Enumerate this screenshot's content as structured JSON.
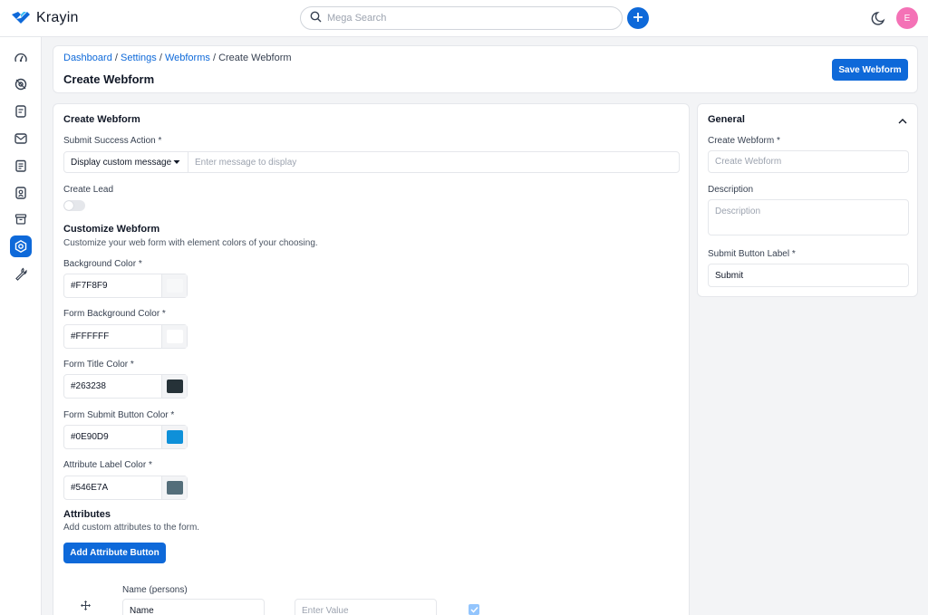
{
  "app": {
    "brand": "Krayin",
    "search_placeholder": "Mega Search",
    "user_initial": "E"
  },
  "icons": {
    "logo": "krayin-logo-icon",
    "search": "search-icon",
    "add": "plus-icon",
    "theme": "moon-icon",
    "sidebar": [
      "dashboard-icon",
      "leads-icon",
      "quotes-icon",
      "mail-icon",
      "activities-icon",
      "contacts-icon",
      "products-icon",
      "settings-icon",
      "configuration-icon"
    ],
    "collapse": "chevron-up-icon",
    "drag": "drag-handle-icon",
    "check": "check-icon"
  },
  "colors": {
    "accent": "#0E69D9",
    "avatar": "#F472B6"
  },
  "breadcrumb": {
    "dashboard": "Dashboard",
    "settings": "Settings",
    "webforms": "Webforms",
    "separator": "/",
    "current": "Create Webform"
  },
  "header": {
    "title": "Create Webform",
    "save_label": "Save Webform"
  },
  "form": {
    "title": "Create Webform",
    "submit_action_label": "Submit Success Action *",
    "submit_action_value": "Display custom message",
    "message_placeholder": "Enter message to display",
    "create_lead_label": "Create Lead",
    "create_lead_enabled": false,
    "customize_title": "Customize Webform",
    "customize_subtitle": "Customize your web form with element colors of your choosing.",
    "colors": [
      {
        "label": "Background Color *",
        "value": "#F7F8F9",
        "swatch": "#F7F8F9"
      },
      {
        "label": "Form Background Color *",
        "value": "#FFFFFF",
        "swatch": "#FFFFFF"
      },
      {
        "label": "Form Title Color *",
        "value": "#263238",
        "swatch": "#263238"
      },
      {
        "label": "Form Submit Button Color *",
        "value": "#0E90D9",
        "swatch": "#0E90D9"
      },
      {
        "label": "Attribute Label Color *",
        "value": "#546E7A",
        "swatch": "#546E7A"
      }
    ],
    "attributes_title": "Attributes",
    "attributes_subtitle": "Add custom attributes to the form.",
    "add_attribute_label": "Add Attribute Button",
    "attribute_rows": [
      {
        "field_label": "Name (persons)",
        "name_value": "Name",
        "value_placeholder": "Enter Value",
        "required": true
      }
    ]
  },
  "general": {
    "title": "General",
    "webform_label": "Create Webform *",
    "webform_placeholder": "Create Webform",
    "description_label": "Description",
    "description_placeholder": "Description",
    "submit_button_label": "Submit Button Label *",
    "submit_button_value": "Submit"
  }
}
